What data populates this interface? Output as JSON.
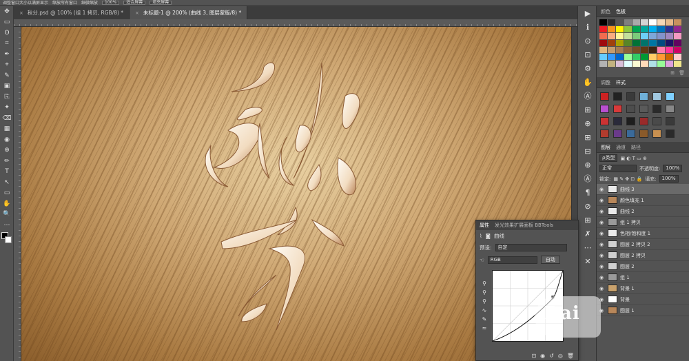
{
  "options_bar": {
    "items": [
      "调整窗口大小以满屏显示",
      "缩放所有窗口",
      "细微缩放",
      "100%",
      "适合屏幕",
      "填充屏幕"
    ]
  },
  "document_tabs": [
    {
      "label": "秋分.psd @ 100% (组 1 拷贝, RGB/8) *",
      "close": "×",
      "active": false
    },
    {
      "label": "未标题-1 @ 200% (曲线 3, 图层蒙版/8) *",
      "close": "×",
      "active": true
    }
  ],
  "tools": [
    "✥",
    "▭",
    "ʘ",
    "⌗",
    "✒",
    "⌖",
    "✎",
    "▣",
    "⎘",
    "✦",
    "⌫",
    "▦",
    "◉",
    "⊕",
    "✏",
    "T",
    "↖",
    "▭",
    "✋",
    "🔍",
    "⋯"
  ],
  "icon_strip": [
    "▶",
    "ℹ",
    "⊙",
    "⊡",
    "⚙",
    "✋",
    "Ⓐ",
    "⊞",
    "⊕",
    "⊞",
    "⊟",
    "⊕",
    "Ⓐ",
    "¶",
    "⊘",
    "⊞",
    "✗",
    "⋯",
    "✕"
  ],
  "color_panel": {
    "tabs": [
      "颜色",
      "色板"
    ],
    "active": "色板"
  },
  "swatch_colors": [
    "#000000",
    "#2b2b2b",
    "#555555",
    "#7f7f7f",
    "#aaaaaa",
    "#d4d4d4",
    "#ffffff",
    "#f5d7b7",
    "#e6b98a",
    "#c8915e",
    "#ed1c24",
    "#f7941d",
    "#fff200",
    "#8dc63f",
    "#00a651",
    "#00a99d",
    "#00aeef",
    "#0072bc",
    "#2e3192",
    "#92278f",
    "#f26c4f",
    "#f9ad81",
    "#fff799",
    "#c4df9b",
    "#7bcb7b",
    "#6dcff6",
    "#7da7d9",
    "#8493ca",
    "#a187be",
    "#f49ac1",
    "#9e0b0f",
    "#a0410d",
    "#aba000",
    "#598527",
    "#007236",
    "#00746b",
    "#0076a3",
    "#004a80",
    "#1b1464",
    "#630460",
    "#e1b67d",
    "#c69c6d",
    "#a67c52",
    "#8c6239",
    "#754c24",
    "#603813",
    "#3c2415",
    "#ff7bac",
    "#ff3399",
    "#cc0066",
    "#66ccff",
    "#3399ff",
    "#0066cc",
    "#99ff99",
    "#33cc66",
    "#009933",
    "#ffcc66",
    "#ff9933",
    "#cc6600",
    "#ffcccc",
    "#b3b3b3",
    "#c2b280",
    "#d8bfd8",
    "#e0ffff",
    "#fafad2",
    "#ffdab9",
    "#b0e0e6",
    "#98fb98",
    "#dda0dd",
    "#f0e68c"
  ],
  "adjust_panel": {
    "tabs": [
      "调整",
      "样式"
    ],
    "active": "样式"
  },
  "style_colors": [
    "#cc2222",
    "#222222",
    "#3a3a3a",
    "#6fb0d8",
    "#a0c8e0",
    "#7fd0ff",
    "#b84fd1",
    "#d83a3a",
    "#4d4d4d",
    "#5a5a5a",
    "#2a2a2a",
    "#888888",
    "#cc3333",
    "#2a2a3a",
    "#1e1e1e",
    "#9a2a2a",
    "#4a4a4a",
    "#3a3a3a",
    "#b23c2e",
    "#6a3a8a",
    "#3a6a9a",
    "#8a5a2a",
    "#c89050",
    "#2a2a2a"
  ],
  "layers_panel": {
    "tabs": [
      "图层",
      "通道",
      "路径"
    ],
    "active": "图层",
    "kind": "ρ类型",
    "blend": "正常",
    "opacity_label": "不透明度:",
    "opacity": "100%",
    "lock_label": "锁定:",
    "fill_label": "填充:",
    "fill": "100%",
    "layers": [
      {
        "name": "曲线 3",
        "thumb": "#eaeaea",
        "selected": true
      },
      {
        "name": "颜色填充 1",
        "thumb": "#b8875a",
        "selected": false
      },
      {
        "name": "曲线 2",
        "thumb": "#eaeaea",
        "selected": false
      },
      {
        "name": "组 1 拷贝",
        "thumb": "#9a9a9a",
        "selected": false
      },
      {
        "name": "色相/饱和度 1",
        "thumb": "#eaeaea",
        "selected": false
      },
      {
        "name": "图层 2 拷贝 2",
        "thumb": "#d0d0d0",
        "selected": false
      },
      {
        "name": "图层 2 拷贝",
        "thumb": "#d0d0d0",
        "selected": false
      },
      {
        "name": "图层 2",
        "thumb": "#d0d0d0",
        "selected": false
      },
      {
        "name": "组 1",
        "thumb": "#9a9a9a",
        "selected": false
      },
      {
        "name": "背景 1",
        "thumb": "#c9a26d",
        "selected": false
      },
      {
        "name": "背景",
        "thumb": "#ffffff",
        "selected": false
      },
      {
        "name": "图层 1",
        "thumb": "#b8875a",
        "selected": false
      }
    ]
  },
  "properties": {
    "tabs": [
      "属性",
      "发光效果扩展面板 BBTools"
    ],
    "title": "曲线",
    "preset_label": "预设:",
    "preset": "自定",
    "channel": "RGB",
    "auto": "自动"
  },
  "watermark": {
    "text": "Bai"
  }
}
